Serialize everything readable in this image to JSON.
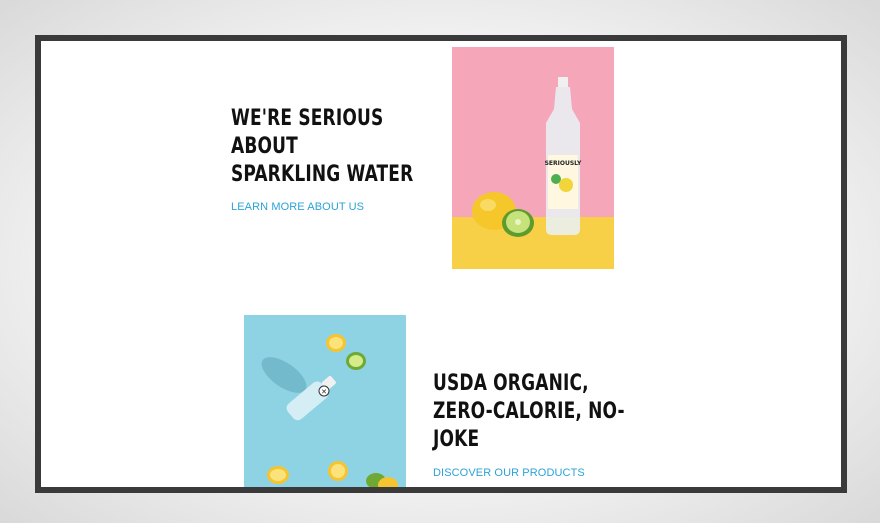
{
  "hero": {
    "heading_lines": [
      "WE'RE SERIOUS",
      "ABOUT",
      "SPARKLING WATER"
    ],
    "link_label": "LEARN MORE ABOUT US",
    "bottle_label": "SERIOUSLY"
  },
  "feature": {
    "heading_lines": [
      "USDA ORGANIC,",
      "ZERO-CALORIE, NO-",
      "JOKE"
    ],
    "link_label": "DISCOVER OUR PRODUCTS"
  },
  "colors": {
    "link": "#2ba3d6",
    "frame_border": "#3a3a3a",
    "photo1_pink": "#f5a6b8",
    "photo1_yellow": "#f7d047",
    "photo2_blue": "#8ed3e3"
  }
}
